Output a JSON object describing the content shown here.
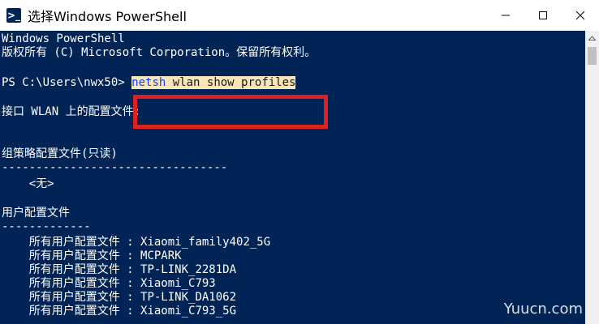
{
  "window": {
    "title": "选择Windows PowerShell",
    "icon": "powershell-icon",
    "icon_glyph": ">_",
    "controls": [
      "minimize-icon",
      "maximize-icon",
      "close-icon"
    ]
  },
  "console": {
    "lines": {
      "banner1": "Windows PowerShell",
      "banner2": "版权所有 (C) Microsoft Corporation。保留所有权利。",
      "prompt": "PS C:\\Users\\nwx50",
      "prompt_sep": "> ",
      "cmd": "netsh",
      "args": " wlan show profiles",
      "interface_header": "接口 WLAN 上的配置文件:",
      "group_policy_header": "组策略配置文件(只读)",
      "group_policy_rule": "---------------------------------",
      "none": "    <无>",
      "user_profiles_header": "用户配置文件",
      "user_profiles_rule": "-------------"
    },
    "profile_label": "    所有用户配置文件 : ",
    "profiles": [
      "Xiaomi_family402_5G",
      "MCPARK",
      "TP-LINK_2281DA",
      "Xiaomi_C793",
      "TP-LINK_DA1062",
      "Xiaomi_C793_5G"
    ]
  },
  "annotation": {
    "color": "#e02020"
  },
  "colors": {
    "console_bg": "#012456",
    "command": "#1040ff",
    "highlight_bg": "#f9e5b6"
  },
  "watermark": "Yuucn.com"
}
